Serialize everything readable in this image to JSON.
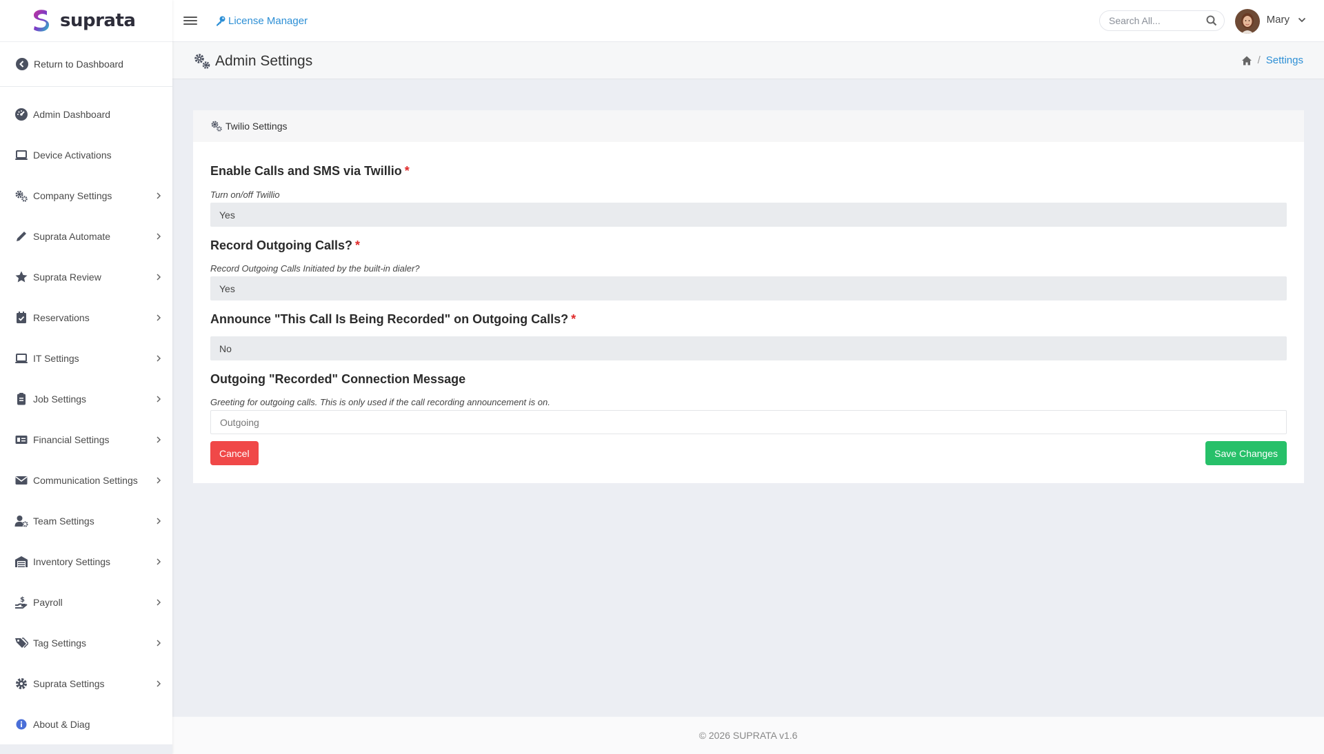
{
  "brand": {
    "name": "suprata",
    "accent": "#2d8fd5"
  },
  "sidebar": {
    "return_label": "Return to Dashboard",
    "items": [
      {
        "label": "Admin Dashboard",
        "icon": "gauge-icon",
        "has_children": false
      },
      {
        "label": "Device Activations",
        "icon": "laptop-icon",
        "has_children": false
      },
      {
        "label": "Company Settings",
        "icon": "gears-icon",
        "has_children": true
      },
      {
        "label": "Suprata Automate",
        "icon": "pencil-icon",
        "has_children": true
      },
      {
        "label": "Suprata Review",
        "icon": "star-icon",
        "has_children": true
      },
      {
        "label": "Reservations",
        "icon": "calendar-check-icon",
        "has_children": true
      },
      {
        "label": "IT Settings",
        "icon": "laptop-icon",
        "has_children": true
      },
      {
        "label": "Job Settings",
        "icon": "clipboard-icon",
        "has_children": true
      },
      {
        "label": "Financial Settings",
        "icon": "money-card-icon",
        "has_children": true
      },
      {
        "label": "Communication Settings",
        "icon": "envelope-icon",
        "has_children": true
      },
      {
        "label": "Team Settings",
        "icon": "user-gear-icon",
        "has_children": true
      },
      {
        "label": "Inventory Settings",
        "icon": "warehouse-icon",
        "has_children": true
      },
      {
        "label": "Payroll",
        "icon": "hand-dollar-icon",
        "has_children": true
      },
      {
        "label": "Tag Settings",
        "icon": "tags-icon",
        "has_children": true
      },
      {
        "label": "Suprata Settings",
        "icon": "gear-icon",
        "has_children": true
      },
      {
        "label": "About & Diag",
        "icon": "info-icon",
        "has_children": false
      }
    ]
  },
  "topbar": {
    "license_label": "License Manager",
    "search_placeholder": "Search All...",
    "user_name": "Mary"
  },
  "page": {
    "title": "Admin Settings",
    "breadcrumb_current": "Settings"
  },
  "card": {
    "title": "Twilio Settings",
    "fields": [
      {
        "label": "Enable Calls and SMS via Twillio",
        "required": true,
        "hint": "Turn on/off Twillio",
        "value": "Yes"
      },
      {
        "label": "Record Outgoing Calls?",
        "required": true,
        "hint": "Record Outgoing Calls Initiated by the built-in dialer?",
        "value": "Yes"
      },
      {
        "label": "Announce \"This Call Is Being Recorded\" on Outgoing Calls?",
        "required": true,
        "hint": "",
        "value": "No"
      },
      {
        "label": "Outgoing \"Recorded\" Connection Message",
        "required": false,
        "hint": "Greeting for outgoing calls. This is only used if the call recording announcement is on.",
        "placeholder": "Outgoing"
      }
    ],
    "cancel_label": "Cancel",
    "save_label": "Save Changes"
  },
  "footer": {
    "text": "© 2026 SUPRATA v1.6"
  }
}
